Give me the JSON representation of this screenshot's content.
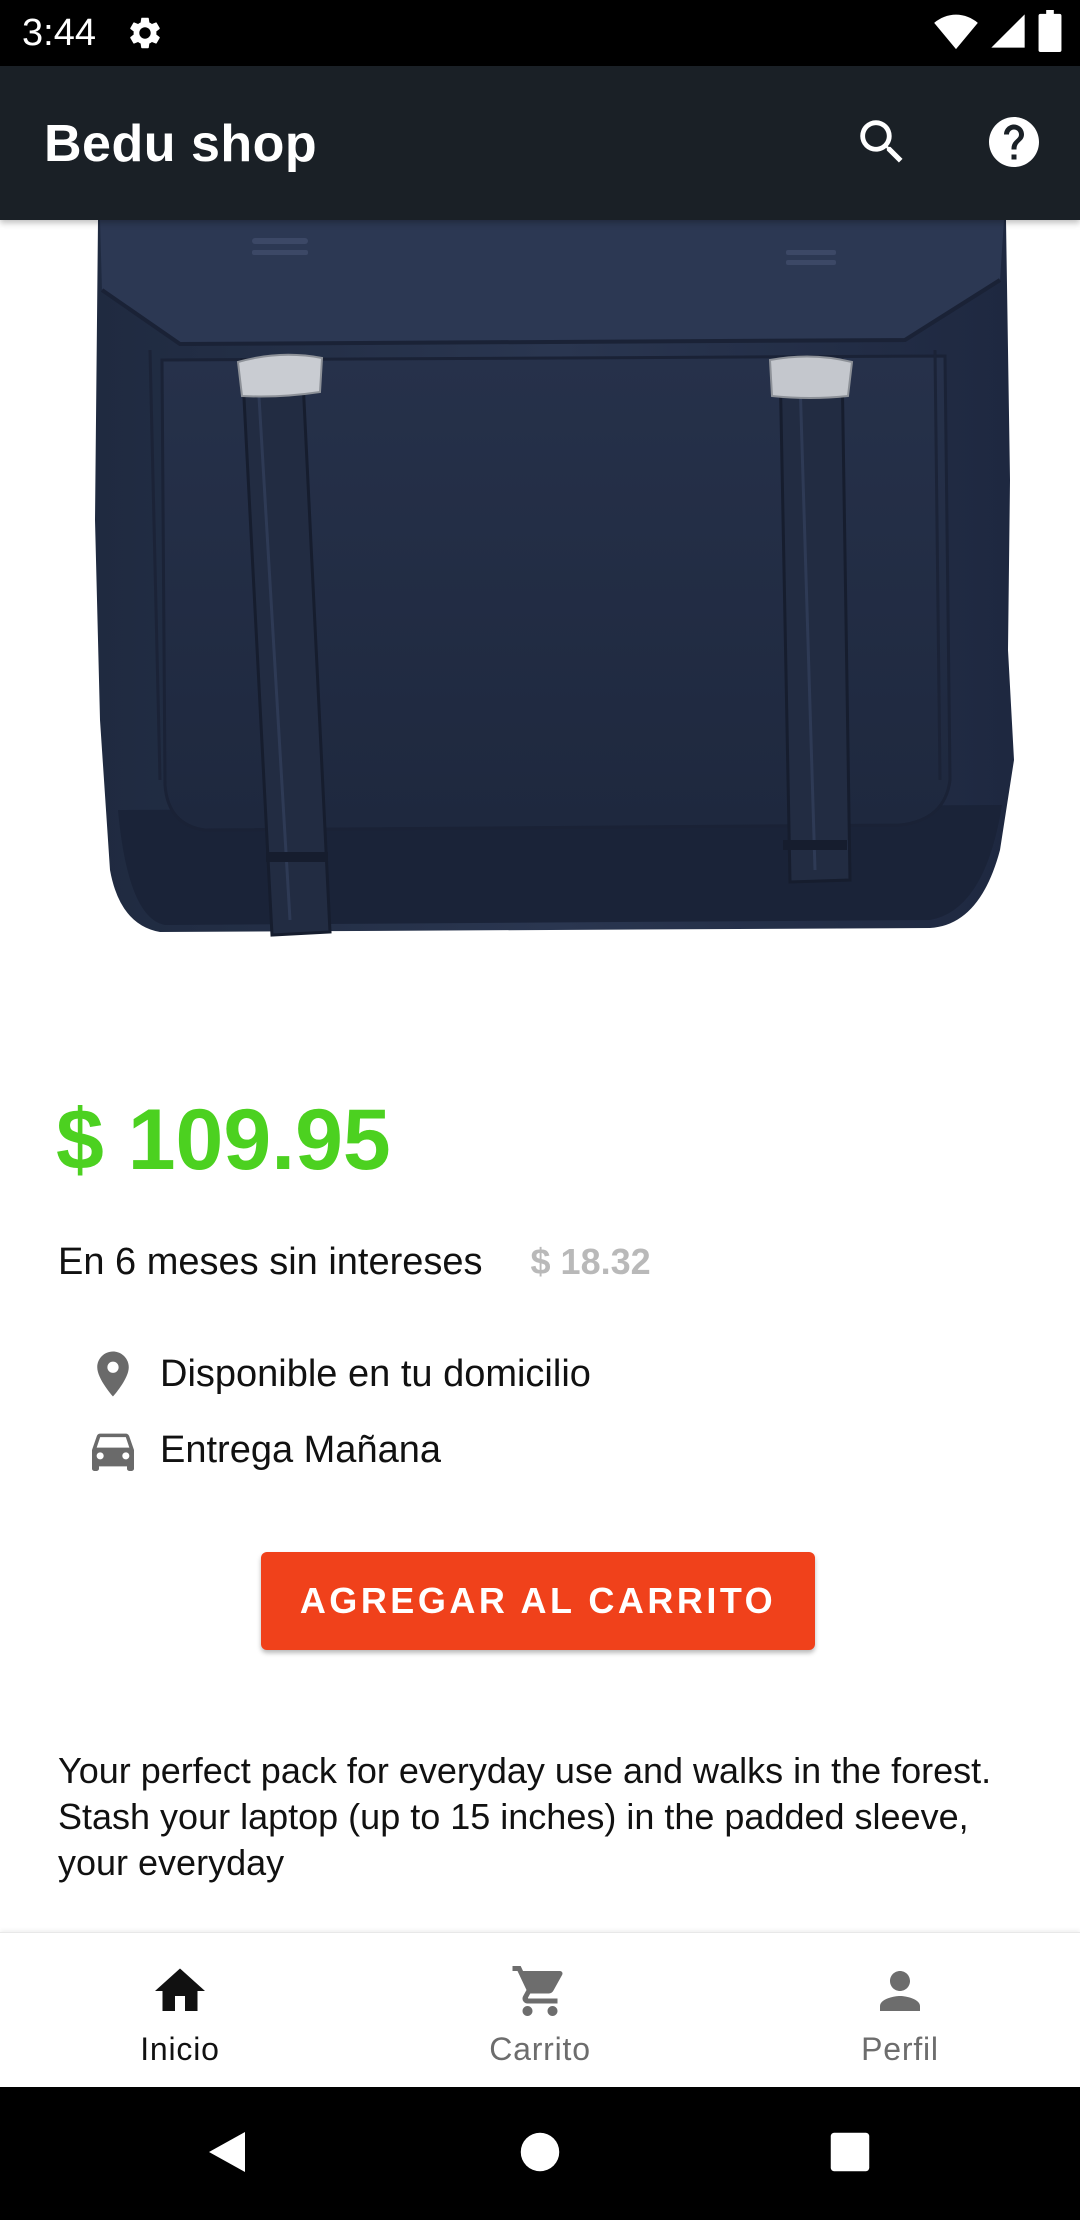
{
  "status_bar": {
    "time": "3:44",
    "icons": [
      "settings-gear-icon",
      "wifi-icon",
      "signal-icon",
      "battery-icon"
    ]
  },
  "app_bar": {
    "title": "Bedu shop",
    "actions": [
      "search-icon",
      "help-icon"
    ]
  },
  "product": {
    "image": "navy-backpack-photo",
    "price": "$ 109.95",
    "installments_label": "En 6 meses sin intereses",
    "installments_amount": "$ 18.32",
    "availability": "Disponible en tu domicilio",
    "delivery": "Entrega Mañana",
    "add_to_cart_label": "AGREGAR AL CARRITO",
    "description": "Your perfect pack for everyday use and walks in the forest. Stash your laptop (up to 15 inches) in the padded sleeve, your everyday"
  },
  "bottom_nav": {
    "items": [
      {
        "label": "Inicio",
        "icon": "home-icon",
        "active": true
      },
      {
        "label": "Carrito",
        "icon": "cart-icon",
        "active": false
      },
      {
        "label": "Perfil",
        "icon": "person-icon",
        "active": false
      }
    ]
  },
  "system_nav": [
    "back-icon",
    "home-circle-icon",
    "recents-icon"
  ],
  "colors": {
    "app_bar": "#1a2026",
    "price": "#4cd120",
    "button": "#f0411b",
    "muted_amount": "#b9b9b9",
    "backpack": "#26324a"
  }
}
